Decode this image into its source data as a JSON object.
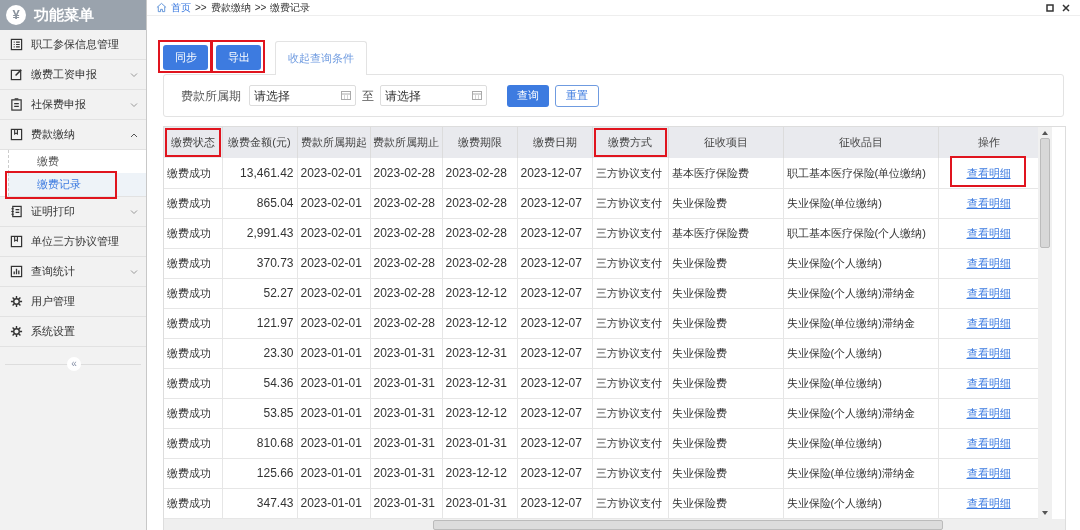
{
  "sidebar": {
    "title": "功能菜单",
    "logo": "¥",
    "collapse": "«",
    "items": [
      {
        "label": "职工参保信息管理",
        "kind": "link"
      },
      {
        "label": "缴费工资申报",
        "kind": "group",
        "expanded": false
      },
      {
        "label": "社保费申报",
        "kind": "group",
        "expanded": false
      },
      {
        "label": "费款缴纳",
        "kind": "group",
        "expanded": true,
        "children": [
          {
            "label": "缴费",
            "selected": false,
            "highlighted": false
          },
          {
            "label": "缴费记录",
            "selected": true,
            "highlighted": true
          }
        ]
      },
      {
        "label": "证明打印",
        "kind": "group",
        "expanded": false
      },
      {
        "label": "单位三方协议管理",
        "kind": "link"
      },
      {
        "label": "查询统计",
        "kind": "group",
        "expanded": false
      },
      {
        "label": "用户管理",
        "kind": "link"
      },
      {
        "label": "系统设置",
        "kind": "link"
      }
    ]
  },
  "breadcrumb": [
    "首页",
    "费款缴纳",
    "缴费记录"
  ],
  "breadcrumb_separator": ">>",
  "toolbar": [
    {
      "label": "同步",
      "highlighted": true
    },
    {
      "label": "导出",
      "highlighted": true
    }
  ],
  "filter_tab": "收起查询条件",
  "filter": {
    "label": "费款所属期",
    "from": {
      "placeholder": "请选择"
    },
    "to_label": "至",
    "to": {
      "placeholder": "请选择"
    },
    "query": "查询",
    "reset": "重置"
  },
  "table": {
    "columns": [
      {
        "label": "缴费状态",
        "highlighted": true
      },
      {
        "label": "缴费金额(元)",
        "highlighted": false
      },
      {
        "label": "费款所属期起",
        "highlighted": false
      },
      {
        "label": "费款所属期止",
        "highlighted": false
      },
      {
        "label": "缴费期限",
        "highlighted": false
      },
      {
        "label": "缴费日期",
        "highlighted": false
      },
      {
        "label": "缴费方式",
        "highlighted": true
      },
      {
        "label": "征收项目",
        "highlighted": false
      },
      {
        "label": "征收品目",
        "highlighted": false
      },
      {
        "label": "操作",
        "highlighted": false
      }
    ],
    "rows": [
      {
        "cells": [
          "缴费成功",
          "13,461.42",
          "2023-02-01",
          "2023-02-28",
          "2023-02-28",
          "2023-12-07",
          "三方协议支付",
          "基本医疗保险费",
          "职工基本医疗保险(单位缴纳)"
        ],
        "action": "查看明细",
        "highlighted": true
      },
      {
        "cells": [
          "缴费成功",
          "865.04",
          "2023-02-01",
          "2023-02-28",
          "2023-02-28",
          "2023-12-07",
          "三方协议支付",
          "失业保险费",
          "失业保险(单位缴纳)"
        ],
        "action": "查看明细",
        "highlighted": false
      },
      {
        "cells": [
          "缴费成功",
          "2,991.43",
          "2023-02-01",
          "2023-02-28",
          "2023-02-28",
          "2023-12-07",
          "三方协议支付",
          "基本医疗保险费",
          "职工基本医疗保险(个人缴纳)"
        ],
        "action": "查看明细",
        "highlighted": false
      },
      {
        "cells": [
          "缴费成功",
          "370.73",
          "2023-02-01",
          "2023-02-28",
          "2023-02-28",
          "2023-12-07",
          "三方协议支付",
          "失业保险费",
          "失业保险(个人缴纳)"
        ],
        "action": "查看明细",
        "highlighted": false
      },
      {
        "cells": [
          "缴费成功",
          "52.27",
          "2023-02-01",
          "2023-02-28",
          "2023-12-12",
          "2023-12-07",
          "三方协议支付",
          "失业保险费",
          "失业保险(个人缴纳)滞纳金"
        ],
        "action": "查看明细",
        "highlighted": false
      },
      {
        "cells": [
          "缴费成功",
          "121.97",
          "2023-02-01",
          "2023-02-28",
          "2023-12-12",
          "2023-12-07",
          "三方协议支付",
          "失业保险费",
          "失业保险(单位缴纳)滞纳金"
        ],
        "action": "查看明细",
        "highlighted": false
      },
      {
        "cells": [
          "缴费成功",
          "23.30",
          "2023-01-01",
          "2023-01-31",
          "2023-12-31",
          "2023-12-07",
          "三方协议支付",
          "失业保险费",
          "失业保险(个人缴纳)"
        ],
        "action": "查看明细",
        "highlighted": false
      },
      {
        "cells": [
          "缴费成功",
          "54.36",
          "2023-01-01",
          "2023-01-31",
          "2023-12-31",
          "2023-12-07",
          "三方协议支付",
          "失业保险费",
          "失业保险(单位缴纳)"
        ],
        "action": "查看明细",
        "highlighted": false
      },
      {
        "cells": [
          "缴费成功",
          "53.85",
          "2023-01-01",
          "2023-01-31",
          "2023-12-12",
          "2023-12-07",
          "三方协议支付",
          "失业保险费",
          "失业保险(个人缴纳)滞纳金"
        ],
        "action": "查看明细",
        "highlighted": false
      },
      {
        "cells": [
          "缴费成功",
          "810.68",
          "2023-01-01",
          "2023-01-31",
          "2023-01-31",
          "2023-12-07",
          "三方协议支付",
          "失业保险费",
          "失业保险(单位缴纳)"
        ],
        "action": "查看明细",
        "highlighted": false
      },
      {
        "cells": [
          "缴费成功",
          "125.66",
          "2023-01-01",
          "2023-01-31",
          "2023-12-12",
          "2023-12-07",
          "三方协议支付",
          "失业保险费",
          "失业保险(单位缴纳)滞纳金"
        ],
        "action": "查看明细",
        "highlighted": false
      },
      {
        "cells": [
          "缴费成功",
          "347.43",
          "2023-01-01",
          "2023-01-31",
          "2023-01-31",
          "2023-12-07",
          "三方协议支付",
          "失业保险费",
          "失业保险(个人缴纳)"
        ],
        "action": "查看明细",
        "highlighted": false
      }
    ]
  }
}
